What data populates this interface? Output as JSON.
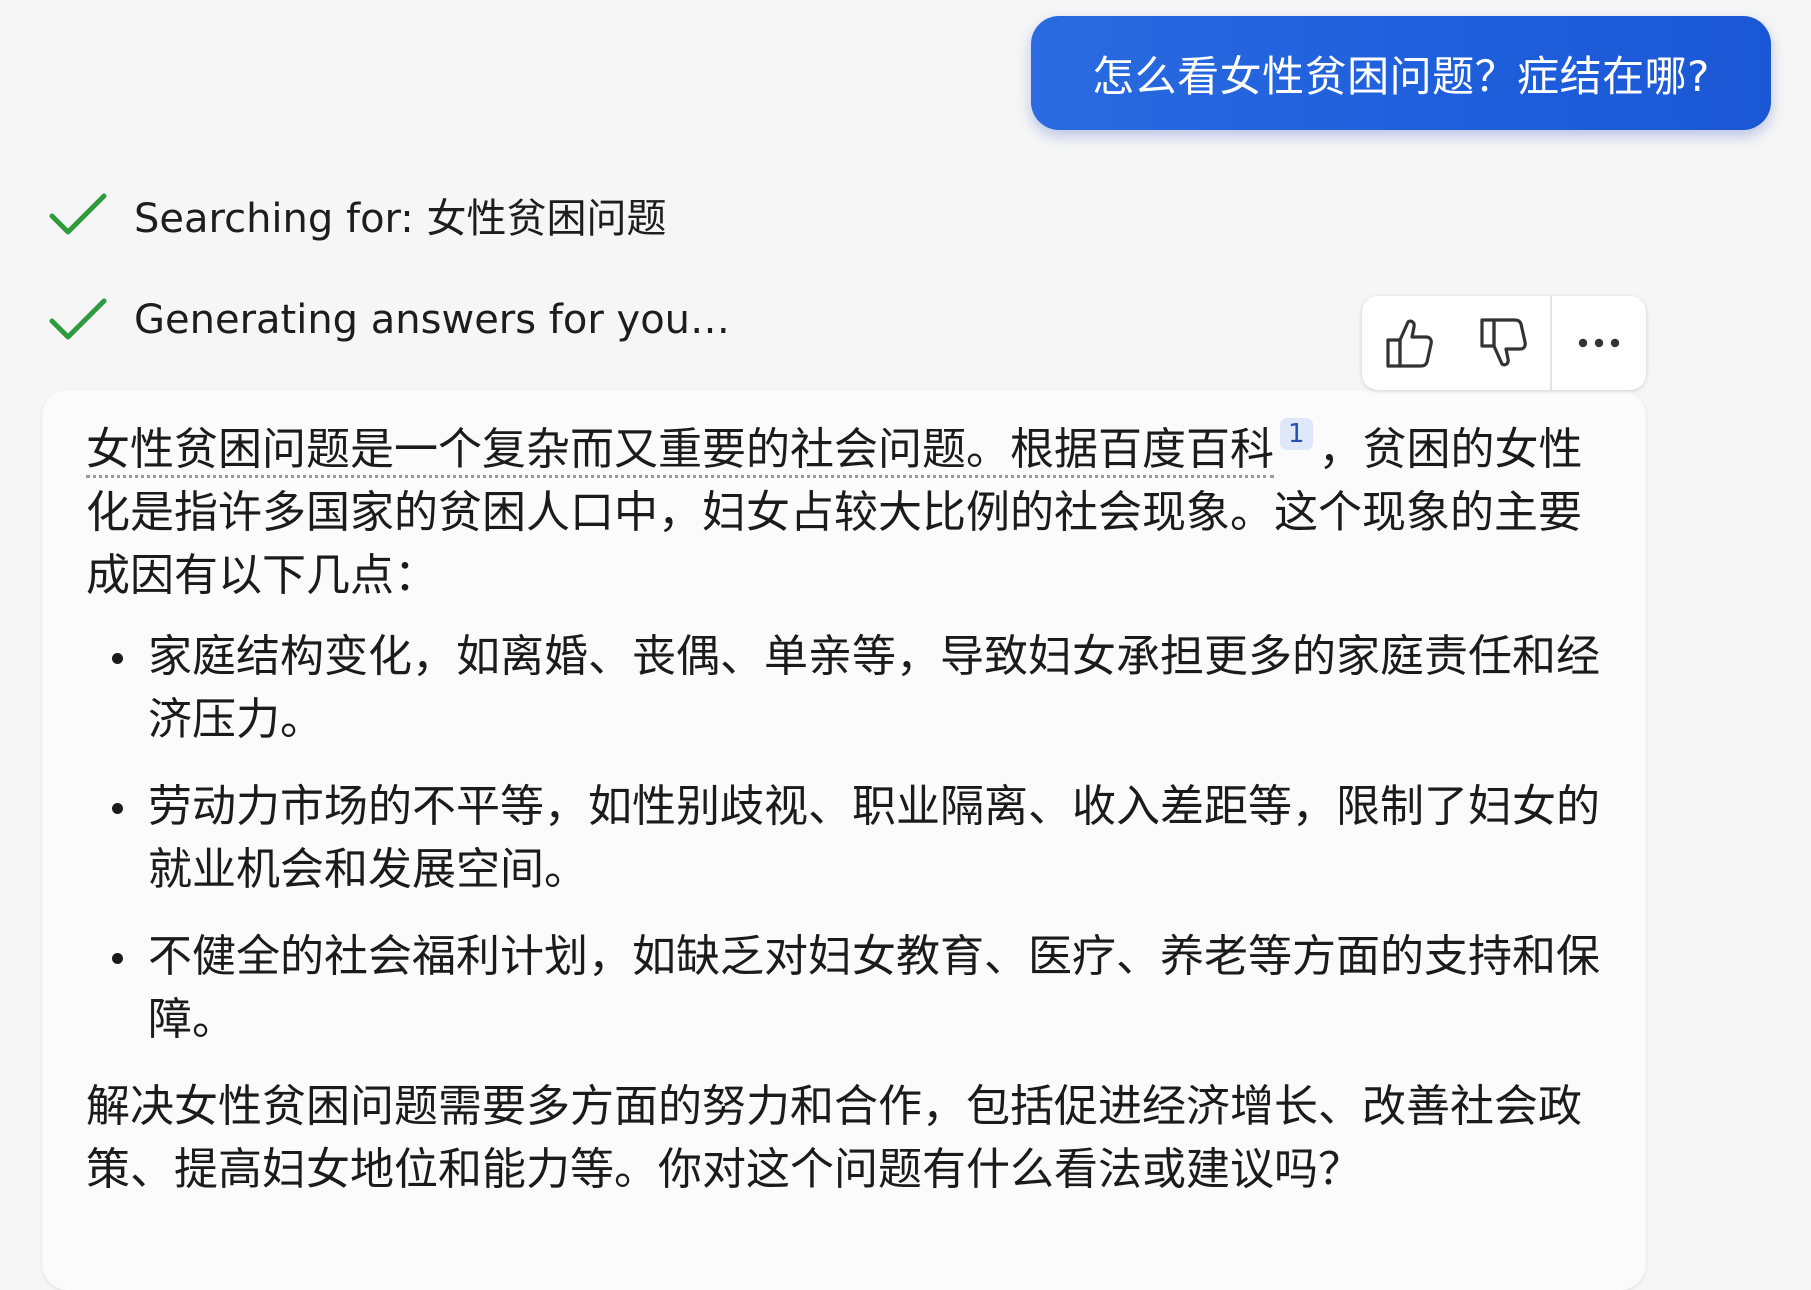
{
  "user_message": {
    "text": "怎么看女性贫困问题？症结在哪?"
  },
  "status": {
    "searching_label": "Searching for: 女性贫困问题",
    "generating_label": "Generating answers for you…",
    "check_color": "#2e9b3e"
  },
  "feedback": {
    "like_icon": "thumbs-up-icon",
    "dislike_icon": "thumbs-down-icon",
    "more_icon": "ellipsis-icon"
  },
  "answer": {
    "intro_cited": "女性贫困问题是一个复杂而又重要的社会问题。根据百度百科",
    "citation_number": "1",
    "intro_rest": "，贫困的女性化是指许多国家的贫困人口中，妇女占较大比例的社会现象。这个现象的主要成因有以下几点：",
    "bullets": [
      "家庭结构变化，如离婚、丧偶、单亲等，导致妇女承担更多的家庭责任和经济压力。",
      "劳动力市场的不平等，如性别歧视、职业隔离、收入差距等，限制了妇女的就业机会和发展空间。",
      "不健全的社会福利计划，如缺乏对妇女教育、医疗、养老等方面的支持和保障。"
    ],
    "conclusion": "解决女性贫困问题需要多方面的努力和合作，包括促进经济增长、改善社会政策、提高妇女地位和能力等。你对这个问题有什么看法或建议吗？"
  },
  "colors": {
    "user_bubble": "#1f5fdc",
    "citation_badge_bg": "#dfe8fb",
    "citation_badge_text": "#2452b8"
  }
}
